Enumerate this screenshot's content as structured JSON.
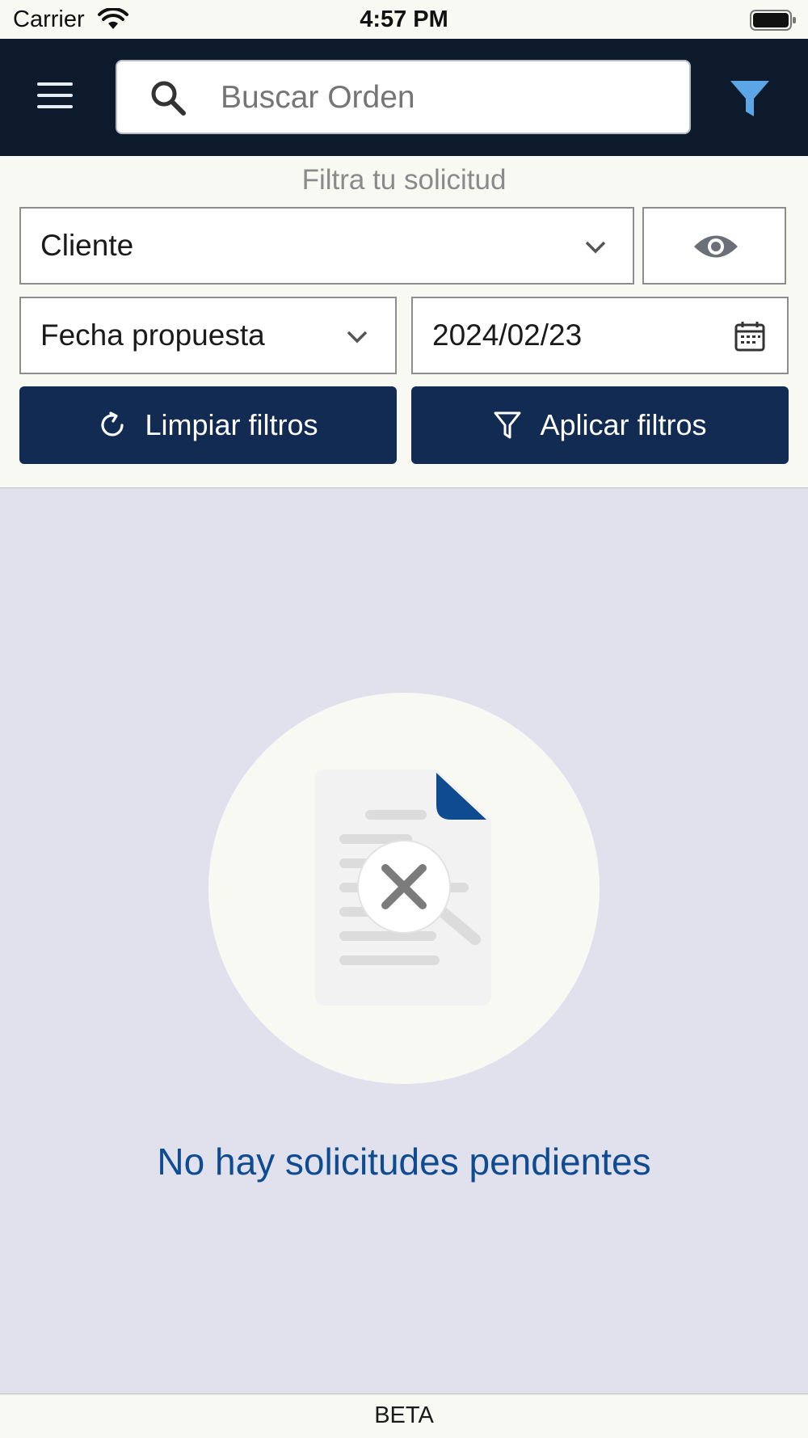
{
  "status_bar": {
    "carrier": "Carrier",
    "time": "4:57 PM"
  },
  "header": {
    "search_placeholder": "Buscar Orden"
  },
  "filters": {
    "title": "Filtra tu solicitud",
    "client_select": "Cliente",
    "date_type_select": "Fecha propuesta",
    "date_value": "2024/02/23",
    "clear_label": "Limpiar filtros",
    "apply_label": "Aplicar filtros"
  },
  "empty_state": {
    "message": "No hay solicitudes pendientes"
  },
  "footer": {
    "label": "BETA"
  },
  "colors": {
    "header_bg": "#0d1a2b",
    "button_bg": "#122b52",
    "accent_blue": "#0e4b90",
    "filter_icon": "#5ba6e6",
    "content_bg": "#e0e1ec"
  },
  "icons": [
    "wifi-icon",
    "battery-icon",
    "hamburger-menu-icon",
    "search-icon",
    "filter-icon",
    "chevron-down-icon",
    "eye-icon",
    "calendar-icon",
    "refresh-icon",
    "document-not-found-icon"
  ]
}
